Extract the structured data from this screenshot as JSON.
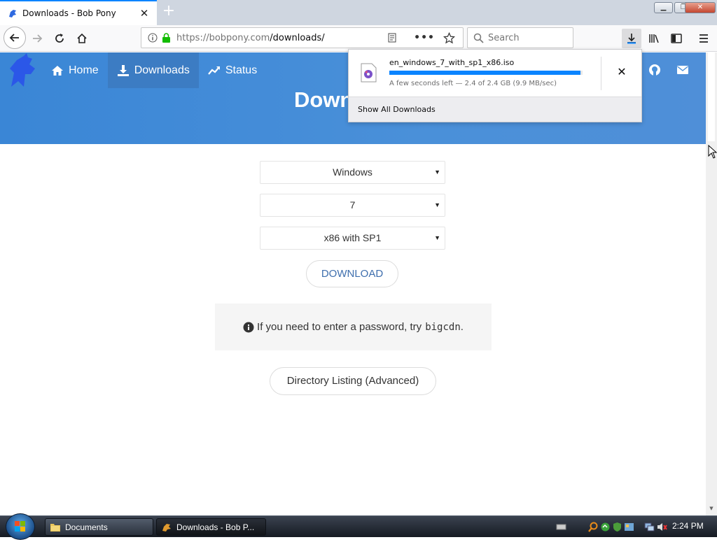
{
  "browser": {
    "tab": {
      "title": "Downloads - Bob Pony"
    },
    "url": {
      "host": "https://bobpony.com",
      "path": "/downloads/"
    },
    "search": {
      "placeholder": "Search"
    }
  },
  "site": {
    "nav": [
      {
        "label": "Home",
        "icon": "home-icon"
      },
      {
        "label": "Downloads",
        "icon": "download-icon",
        "active": true
      },
      {
        "label": "Status",
        "icon": "trend-icon"
      }
    ],
    "hero_title": "Downl",
    "selects": [
      "Windows",
      "7",
      "x86 with SP1"
    ],
    "download_label": "DOWNLOAD",
    "notice": {
      "text": "If you need to enter a password, try",
      "code": "bigcdn",
      "tail": "."
    },
    "directory_label": "Directory Listing (Advanced)",
    "colors": {
      "hero": "#4a90d9",
      "link": "#3f6fae"
    }
  },
  "download_panel": {
    "filename": "en_windows_7_with_sp1_x86.iso",
    "status": "A few seconds left — 2.4 of 2.4 GB (9.9 MB/sec)",
    "progress": 0.99,
    "footer": "Show All Downloads",
    "accent": "#0a84ff"
  },
  "taskbar": {
    "items": [
      {
        "label": "Documents"
      },
      {
        "label": "Downloads - Bob P..."
      }
    ],
    "clock": "2:24 PM"
  }
}
